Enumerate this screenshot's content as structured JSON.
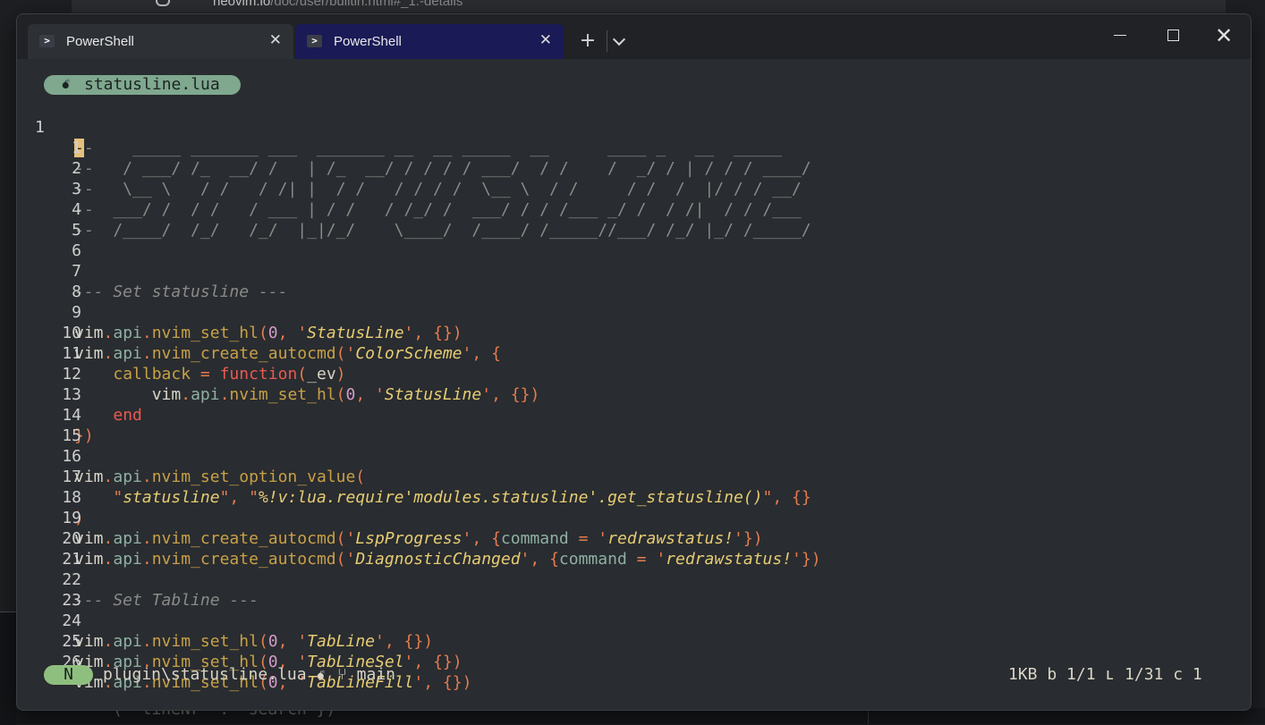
{
  "background": {
    "url_host": "neovim.io",
    "url_path": "/doc/user/builtin.html#_1.-details",
    "bottom_snippet": "(  lineNr  :  search })"
  },
  "tabs": [
    {
      "label": "PowerShell",
      "icon": "powershell-icon",
      "active": false
    },
    {
      "label": "PowerShell",
      "icon": "powershell-icon",
      "active": true
    }
  ],
  "titlebar": {
    "new_tab": "+",
    "close": "✕"
  },
  "editor": {
    "file_tab": {
      "icon": "bomb-icon",
      "name": "statusline.lua"
    },
    "current_line_number": "1",
    "lines": [
      {
        "n": "1",
        "text": "--    _____ _______ ___  _______ __  __ _____  __      ____ _   __  _____"
      },
      {
        "n": "1",
        "text": "--   / ___/ /_  __/ /   | /_  __/ / / / / ___/  / /    /  _/ / | / / / ____/"
      },
      {
        "n": "2",
        "text": "--   \\__ \\   / /   / /| |  / /   / / / /  \\__ \\  / /     / /  /  |/ / / __/"
      },
      {
        "n": "3",
        "text": "--  ___/ /  / /   / ___ | / /   / /_/ /  ___/ / / /___ _/ /  / /|  / / /___"
      },
      {
        "n": "4",
        "text": "--  /____/  /_/   /_/  |_|/_/    \\____/  /____/ /_____//___/ /_/ |_/ /_____/"
      },
      {
        "n": "5",
        "text": ""
      },
      {
        "n": "6",
        "text": ""
      },
      {
        "n": "7",
        "text": "--- Set statusline ---"
      },
      {
        "n": "8",
        "text": ""
      },
      {
        "n": "9",
        "text": "vim.api.nvim_set_hl(0, 'StatusLine', {})"
      },
      {
        "n": "10",
        "text": "vim.api.nvim_create_autocmd('ColorScheme', {"
      },
      {
        "n": "11",
        "text": "    callback = function(_ev)"
      },
      {
        "n": "12",
        "text": "        vim.api.nvim_set_hl(0, 'StatusLine', {})"
      },
      {
        "n": "13",
        "text": "    end"
      },
      {
        "n": "14",
        "text": "})"
      },
      {
        "n": "15",
        "text": ""
      },
      {
        "n": "16",
        "text": "vim.api.nvim_set_option_value("
      },
      {
        "n": "17",
        "text": "    \"statusline\", \"%!v:lua.require'modules.statusline'.get_statusline()\", {}"
      },
      {
        "n": "18",
        "text": ")"
      },
      {
        "n": "19",
        "text": "vim.api.nvim_create_autocmd('LspProgress', {command = 'redrawstatus!'})"
      },
      {
        "n": "20",
        "text": "vim.api.nvim_create_autocmd('DiagnosticChanged', {command = 'redrawstatus!'})"
      },
      {
        "n": "21",
        "text": ""
      },
      {
        "n": "22",
        "text": "--- Set Tabline ---"
      },
      {
        "n": "23",
        "text": ""
      },
      {
        "n": "24",
        "text": "vim.api.nvim_set_hl(0, 'TabLine', {})"
      },
      {
        "n": "25",
        "text": "vim.api.nvim_set_hl(0, 'TabLineSel', {})"
      },
      {
        "n": "26",
        "text": "vim.api.nvim_set_hl(0, 'TabLineFill', {})"
      }
    ]
  },
  "statusline": {
    "mode": "N",
    "path": "plugin\\statusline.lua",
    "file_icon": "bomb-icon",
    "branch_icon": "git-branch-icon",
    "branch": "main",
    "right": "1KB b 1/1 ʟ 1/31 c 1"
  },
  "colors": {
    "mode_bg": "#8fbf7f",
    "file_tab_bg": "#7fa88f",
    "active_tab_bg": "#1a1a56",
    "editor_bg": "#292c30"
  }
}
